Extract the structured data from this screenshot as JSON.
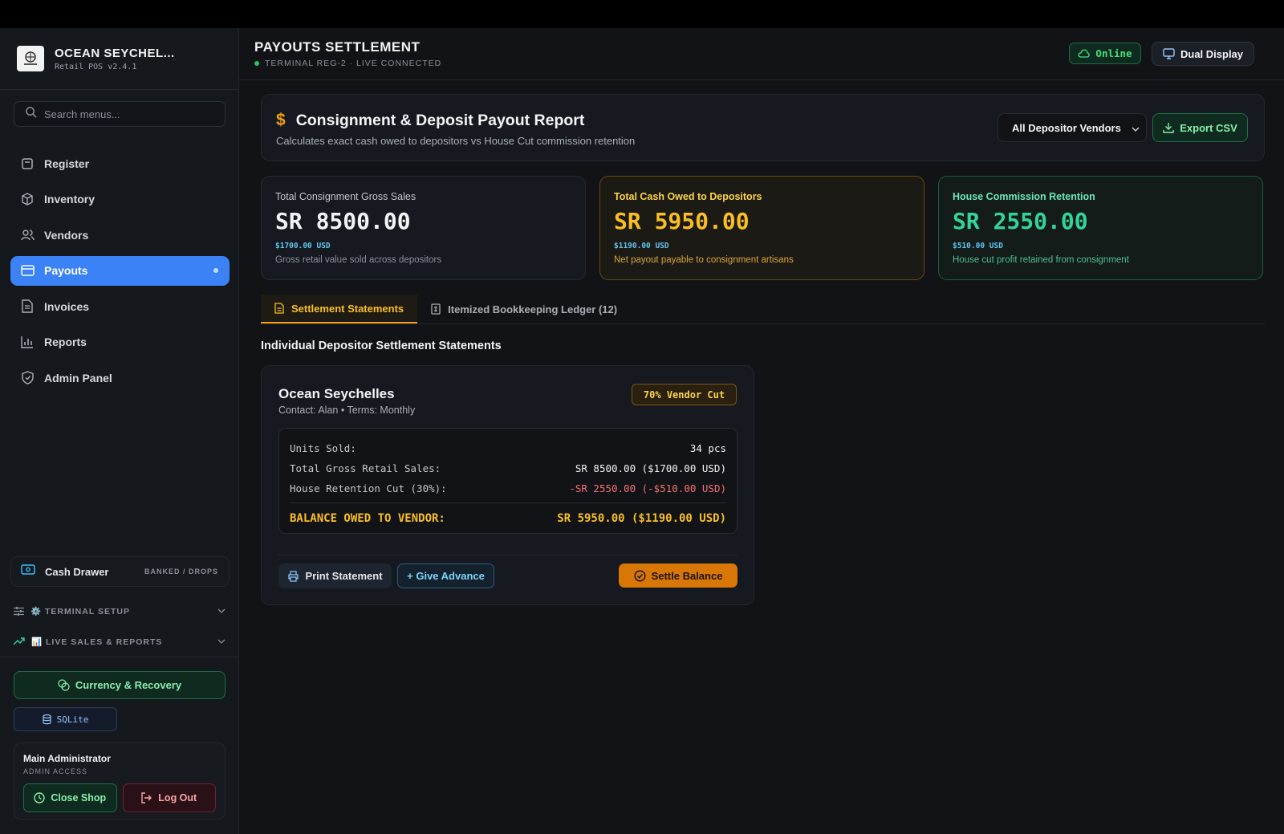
{
  "brand": {
    "name": "OCEAN SEYCHEL...",
    "version": "Retail POS v2.4.1"
  },
  "search": {
    "placeholder": "Search menus..."
  },
  "nav": [
    {
      "label": "Register",
      "icon": "register-icon"
    },
    {
      "label": "Inventory",
      "icon": "box-icon"
    },
    {
      "label": "Vendors",
      "icon": "users-icon"
    },
    {
      "label": "Payouts",
      "icon": "card-icon",
      "active": true
    },
    {
      "label": "Invoices",
      "icon": "document-icon"
    },
    {
      "label": "Reports",
      "icon": "bar-chart-icon"
    },
    {
      "label": "Admin Panel",
      "icon": "shield-icon"
    }
  ],
  "cash_drawer": {
    "label": "Cash Drawer",
    "tag": "BANKED / DROPS"
  },
  "sections": {
    "terminal_setup": "⚙️ TERMINAL SETUP",
    "live_sales": "📊 LIVE SALES & REPORTS"
  },
  "currency_button": "Currency & Recovery",
  "db_badge": "SQLite",
  "user": {
    "name": "Main Administrator",
    "role": "ADMIN ACCESS",
    "close_label": "Close Shop",
    "logout_label": "Log Out"
  },
  "header": {
    "title": "PAYOUTS SETTLEMENT",
    "subtitle": "TERMINAL REG-2 · LIVE CONNECTED",
    "status": "Online",
    "dual_display": "Dual Display"
  },
  "report": {
    "title": "Consignment & Deposit Payout Report",
    "description": "Calculates exact cash owed to depositors vs House Cut commission retention",
    "filter_value": "All Depositor Vendors",
    "export_label": "Export CSV"
  },
  "stats": [
    {
      "label": "Total Consignment Gross Sales",
      "value": "SR 8500.00",
      "usd": "$1700.00 USD",
      "desc": "Gross retail value sold across depositors"
    },
    {
      "label": "Total Cash Owed to Depositors",
      "value": "SR 5950.00",
      "usd": "$1190.00 USD",
      "desc": "Net payout payable to consignment artisans"
    },
    {
      "label": "House Commission Retention",
      "value": "SR 2550.00",
      "usd": "$510.00 USD",
      "desc": "House cut profit retained from consignment"
    }
  ],
  "tabs": [
    {
      "label": "Settlement Statements",
      "active": true
    },
    {
      "label": "Itemized Bookkeeping Ledger (12)",
      "active": false
    }
  ],
  "section_title": "Individual Depositor Settlement Statements",
  "vendor_card": {
    "name": "Ocean Seychelles",
    "meta": "Contact: Alan • Terms: Monthly",
    "cut_badge": "70% Vendor Cut",
    "rows": [
      {
        "label": "Units Sold:",
        "value": "34 pcs"
      },
      {
        "label": "Total Gross Retail Sales:",
        "value": "SR 8500.00 ($1700.00 USD)"
      },
      {
        "label": "House Retention Cut (30%):",
        "value": "-SR 2550.00 (-$510.00 USD)"
      }
    ],
    "total_label": "BALANCE OWED TO VENDOR:",
    "total_value": "SR 5950.00 ($1190.00 USD)",
    "print_label": "Print Statement",
    "advance_label": "+ Give Advance",
    "settle_label": "Settle Balance"
  },
  "colors": {
    "accent_blue": "#3b82f6",
    "amber": "#f59e0b",
    "green": "#22c55e",
    "red": "#f87171"
  }
}
